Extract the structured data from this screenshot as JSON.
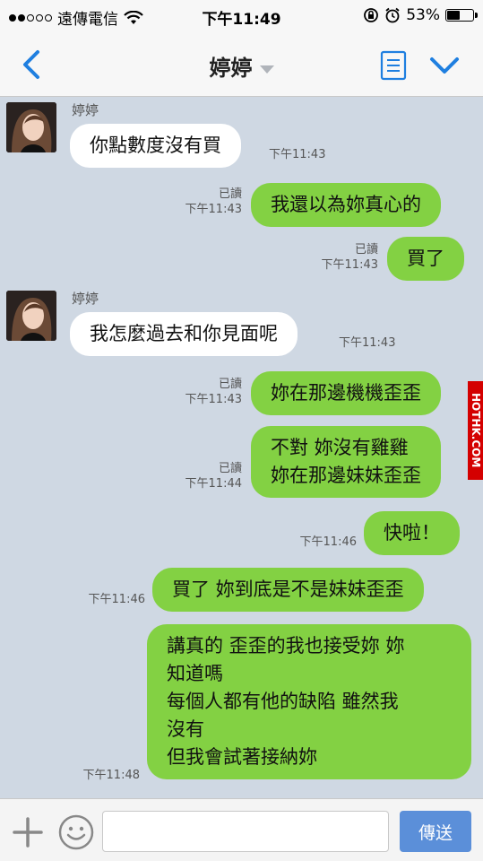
{
  "status_bar": {
    "carrier": "遠傳電信",
    "time": "下午11:49",
    "battery_text": "53%",
    "battery_level": 0.53
  },
  "header": {
    "title": "婷婷",
    "back_icon": "chevron-left-icon",
    "note_icon": "note-icon",
    "menu_icon": "chevron-down-icon"
  },
  "messages": [
    {
      "side": "in",
      "sender": "婷婷",
      "text": "你點數度沒有買",
      "time": "下午11:43"
    },
    {
      "side": "out",
      "read": "已讀",
      "text": "我還以為妳真心的",
      "time": "下午11:43"
    },
    {
      "side": "out",
      "read": "已讀",
      "text": "買了",
      "time": "下午11:43"
    },
    {
      "side": "in",
      "sender": "婷婷",
      "text": "我怎麼過去和你見面呢",
      "time": "下午11:43"
    },
    {
      "side": "out",
      "read": "已讀",
      "text": "妳在那邊機機歪歪",
      "time": "下午11:43"
    },
    {
      "side": "out",
      "read": "已讀",
      "text": "不對 妳沒有雞雞\n妳在那邊妹妹歪歪",
      "time": "下午11:44"
    },
    {
      "side": "out",
      "text": "快啦！",
      "time": "下午11:46"
    },
    {
      "side": "out",
      "text": "買了 妳到底是不是妹妹歪歪",
      "time": "下午11:46"
    },
    {
      "side": "out",
      "text": "講真的 歪歪的我也接受妳 妳\n知道嗎\n每個人都有他的缺陷 雖然我\n沒有\n但我會試著接納妳",
      "time": "下午11:48"
    }
  ],
  "watermark": "HOTHK.COM",
  "input_bar": {
    "plus_icon": "plus-icon",
    "emoji_icon": "smiley-icon",
    "placeholder": "",
    "send_label": "傳送"
  },
  "colors": {
    "chat_background": "#cfd8e3",
    "out_bubble": "#83d143",
    "in_bubble": "#ffffff",
    "accent": "#1f7fe0",
    "send_button": "#5b8fd9"
  }
}
